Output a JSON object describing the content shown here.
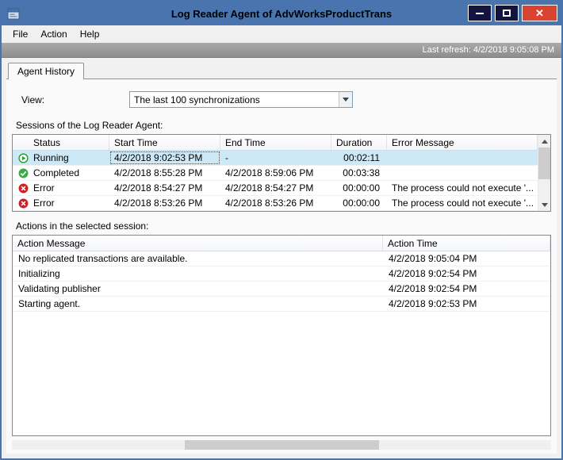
{
  "window": {
    "title": "Log Reader Agent of AdvWorksProductTrans",
    "close_glyph": "✕"
  },
  "menu": {
    "items": [
      "File",
      "Action",
      "Help"
    ]
  },
  "refresh_bar": {
    "text": "Last refresh: 4/2/2018 9:05:08 PM"
  },
  "tabs": [
    {
      "label": "Agent History",
      "active": true
    }
  ],
  "view": {
    "label": "View:",
    "value": "The last 100 synchronizations"
  },
  "sessions": {
    "label": "Sessions of the Log Reader Agent:",
    "columns": [
      "Status",
      "Start Time",
      "End Time",
      "Duration",
      "Error Message"
    ],
    "rows": [
      {
        "icon": "running-icon",
        "status": "Running",
        "start_time": "4/2/2018 9:02:53 PM",
        "end_time": "-",
        "duration": "00:02:11",
        "error_message": "",
        "selected": true
      },
      {
        "icon": "completed-icon",
        "status": "Completed",
        "start_time": "4/2/2018 8:55:28 PM",
        "end_time": "4/2/2018 8:59:06 PM",
        "duration": "00:03:38",
        "error_message": "",
        "selected": false
      },
      {
        "icon": "error-icon",
        "status": "Error",
        "start_time": "4/2/2018 8:54:27 PM",
        "end_time": "4/2/2018 8:54:27 PM",
        "duration": "00:00:00",
        "error_message": "The process could not execute '...",
        "selected": false
      },
      {
        "icon": "error-icon",
        "status": "Error",
        "start_time": "4/2/2018 8:53:26 PM",
        "end_time": "4/2/2018 8:53:26 PM",
        "duration": "00:00:00",
        "error_message": "The process could not execute '...",
        "selected": false
      }
    ]
  },
  "actions": {
    "label": "Actions in the selected session:",
    "columns": [
      "Action Message",
      "Action Time"
    ],
    "rows": [
      {
        "message": "No replicated transactions are available.",
        "time": "4/2/2018 9:05:04 PM"
      },
      {
        "message": "Initializing",
        "time": "4/2/2018 9:02:54 PM"
      },
      {
        "message": "Validating publisher",
        "time": "4/2/2018 9:02:54 PM"
      },
      {
        "message": "Starting agent.",
        "time": "4/2/2018 9:02:53 PM"
      }
    ]
  },
  "icons": {
    "app": "window-icon",
    "minimize": "minimize-icon",
    "maximize": "maximize-icon",
    "close": "close-icon",
    "combo_arrow": "chevron-down-icon",
    "running": "running-icon",
    "completed": "completed-icon",
    "error": "error-icon",
    "scroll_up": "scroll-up-icon",
    "scroll_down": "scroll-down-icon"
  },
  "colors": {
    "titlebar": "#4a74ae",
    "winbtn": "#131340",
    "close_btn": "#d94432",
    "refresh_bar": "#a9a9a9",
    "selected_row": "#cde8f7",
    "running_green": "#2f9e3a",
    "completed_green": "#3aaa46",
    "error_red": "#cc2027"
  }
}
